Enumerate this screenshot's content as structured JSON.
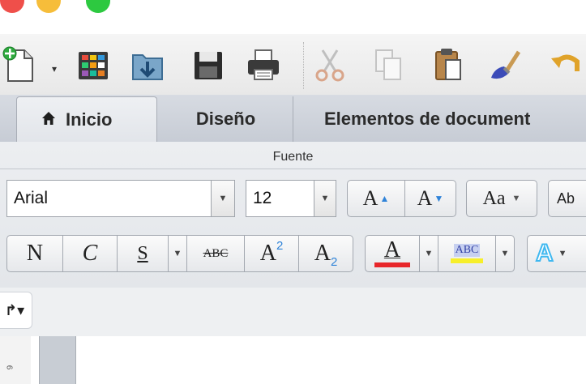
{
  "window": {
    "traffic_lights": [
      "close",
      "minimize",
      "zoom"
    ]
  },
  "toolbar": {
    "buttons": [
      "new-document-icon",
      "templates-gallery-icon",
      "open-icon",
      "save-icon",
      "print-icon",
      "cut-icon",
      "copy-icon",
      "paste-icon",
      "format-painter-icon",
      "undo-icon"
    ]
  },
  "tabs": [
    {
      "label": "Inicio",
      "icon": "home-icon",
      "active": true
    },
    {
      "label": "Diseño",
      "active": false
    },
    {
      "label": "Elementos de document",
      "active": false
    }
  ],
  "ribbon": {
    "group_title": "Fuente",
    "font_name": "Arial",
    "font_size": "12",
    "grow_font": "A",
    "shrink_font": "A",
    "change_case": "Aa",
    "clear_format": "Ab",
    "bold": "N",
    "italic": "C",
    "underline": "S",
    "strikethrough": "ABC",
    "superscript_base": "A",
    "superscript_exp": "2",
    "subscript_base": "A",
    "subscript_exp": "2",
    "font_color_letter": "A",
    "highlight_text": "ABC",
    "text_effects_letter": "A",
    "colors": {
      "font_color": "#e8262a",
      "highlight": "#f7ef2a",
      "text_effects": "#3fb8f0",
      "accent_arrows": "#2f83d8"
    }
  },
  "lower": {
    "small_tool": "↱▾",
    "ruler_mark": "6"
  }
}
